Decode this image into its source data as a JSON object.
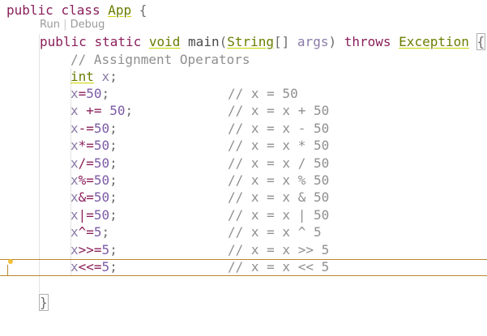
{
  "editor": {
    "class_decl": {
      "kw_public": "public",
      "kw_class": "class",
      "class_name": "App",
      "brace": "{"
    },
    "codelens": {
      "run": "Run",
      "separator": "|",
      "debug": "Debug"
    },
    "main_decl": {
      "kw_public": "public",
      "kw_static": "static",
      "kw_void": "void",
      "name": "main",
      "open_paren": "(",
      "param_type": "String",
      "brackets": "[]",
      "param_name": "args",
      "close_paren": ")",
      "kw_throws": "throws",
      "exception": "Exception",
      "brace": "{"
    },
    "comment_heading": "// Assignment Operators",
    "declaration": {
      "type": "int",
      "var": "x",
      "semi": ";"
    },
    "statements": [
      {
        "var": "x",
        "op": "=",
        "pre": "",
        "value": "50",
        "semi": ";",
        "comment": "// x = 50"
      },
      {
        "var": "x",
        "op": "+=",
        "pre": " ",
        "value": "50",
        "semi": ";",
        "comment": "// x = x + 50"
      },
      {
        "var": "x",
        "op": "-=",
        "pre": "",
        "value": "50",
        "semi": ";",
        "comment": "// x = x - 50"
      },
      {
        "var": "x",
        "op": "*=",
        "pre": "",
        "value": "50",
        "semi": ";",
        "comment": "// x = x * 50"
      },
      {
        "var": "x",
        "op": "/=",
        "pre": "",
        "value": "50",
        "semi": ";",
        "comment": "// x = x / 50"
      },
      {
        "var": "x",
        "op": "%=",
        "pre": "",
        "value": "50",
        "semi": ";",
        "comment": "// x = x % 50"
      },
      {
        "var": "x",
        "op": "&=",
        "pre": "",
        "value": "50",
        "semi": ";",
        "comment": "// x = x & 50"
      },
      {
        "var": "x",
        "op": "|=",
        "pre": "",
        "value": "50",
        "semi": ";",
        "comment": "// x = x | 50"
      },
      {
        "var": "x",
        "op": "^=",
        "pre": "",
        "value": "5",
        "semi": ";",
        "comment": "// x = x ^ 5"
      },
      {
        "var": "x",
        "op": ">>=",
        "pre": "",
        "value": "5",
        "semi": ";",
        "comment": "// x = x >> 5"
      },
      {
        "var": "x",
        "op": "<<=",
        "pre": "",
        "value": "5",
        "semi": ";",
        "comment": "// x = x << 5"
      }
    ],
    "closing_brace": "}",
    "colors": {
      "keyword": "#8a1f5a",
      "type": "#6a7d00",
      "comment": "#8f8f8f",
      "number": "#7b5aa6",
      "current_line_border": "#b8862b",
      "lightbulb": "#f2c037"
    },
    "icons": {
      "gutter": "lightbulb-icon"
    }
  }
}
